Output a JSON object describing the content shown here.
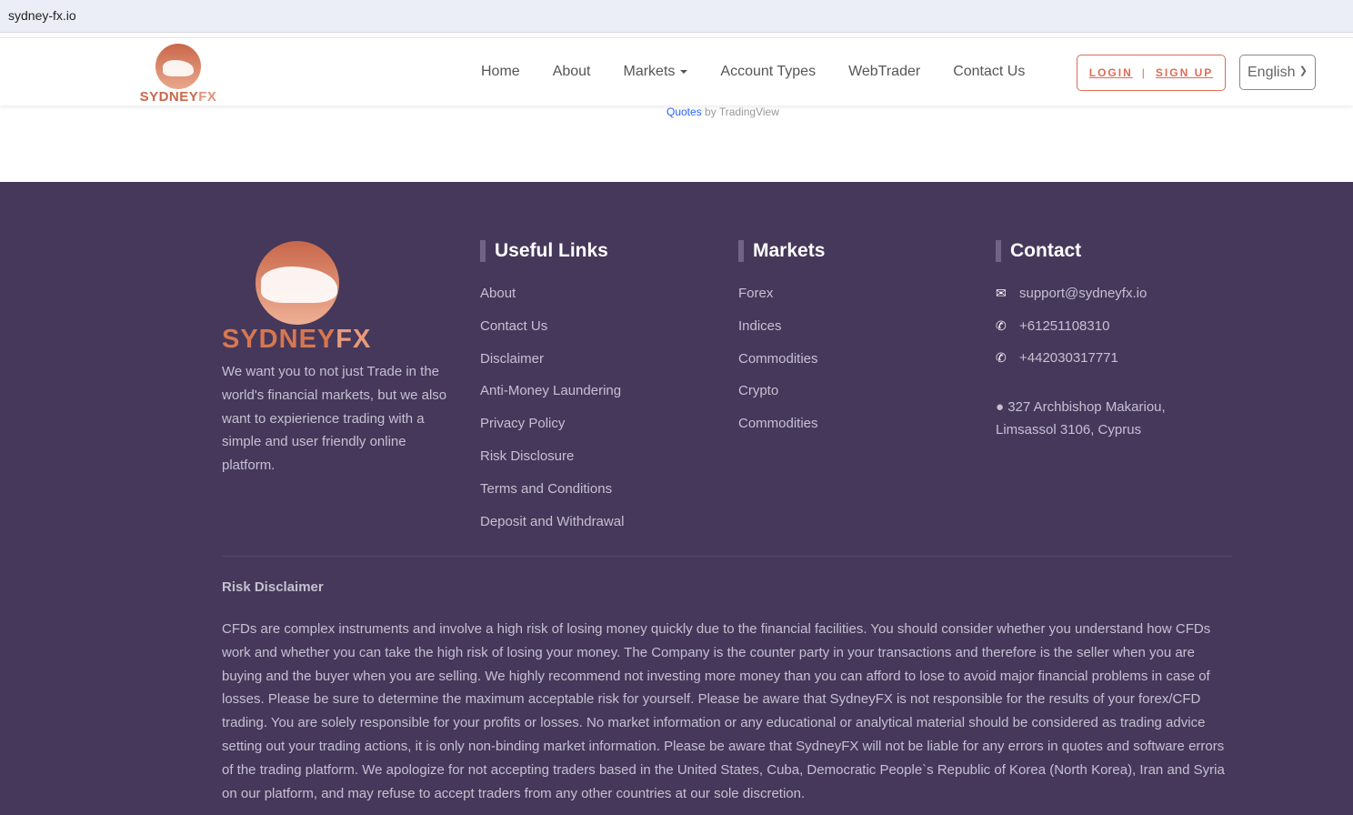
{
  "browser": {
    "url": "sydney-fx.io"
  },
  "header": {
    "logo_text_a": "SYDNEY",
    "logo_text_b": "FX",
    "menu": [
      "Home",
      "About",
      "Markets",
      "Account Types",
      "WebTrader",
      "Contact Us"
    ],
    "login": "LOGIN",
    "signup": "SIGN UP",
    "language": "English"
  },
  "widget": {
    "quotes_link": "Quotes",
    "by": "by TradingView"
  },
  "footer": {
    "about": "We want you to not just Trade in the world's financial markets, but we also want to expierience trading with a simple and user friendly online platform.",
    "useful_links": {
      "title": "Useful Links",
      "items": [
        "About",
        "Contact Us",
        "Disclaimer",
        "Anti-Money Laundering",
        "Privacy Policy",
        "Risk Disclosure",
        "Terms and Conditions",
        "Deposit and Withdrawal"
      ]
    },
    "markets": {
      "title": "Markets",
      "items": [
        "Forex",
        "Indices",
        "Commodities",
        "Crypto",
        "Commodities"
      ]
    },
    "contact": {
      "title": "Contact",
      "email": "support@sydneyfx.io",
      "phone1": "+61251108310",
      "phone2": "+442030317771",
      "address1": "327 Archbishop Makariou,",
      "address2": "Limsassol 3106, Cyprus"
    },
    "risk_title": "Risk Disclaimer",
    "risk_text": "CFDs are complex instruments and involve a high risk of losing money quickly due to the financial facilities. You should consider whether you understand how CFDs work and whether you can take the high risk of losing your money. The Company is the counter party in your transactions and therefore is the seller when you are buying and the buyer when you are selling. We highly recommend not investing more money than you can afford to lose to avoid major financial problems in case of losses. Please be sure to determine the maximum acceptable risk for yourself. Please be aware that SydneyFX is not responsible for the results of your forex/CFD trading. You are solely responsible for your profits or losses. No market information or any educational or analytical material should be considered as trading advice setting out your trading actions, it is only non-binding market information. Please be aware that SydneyFX will not be liable for any errors in quotes and software errors of the trading platform. We apologize for not accepting traders based in the United States, Cuba, Democratic People`s Republic of Korea (North Korea), Iran and Syria on our platform, and may refuse to accept traders from any other countries at our sole discretion."
  }
}
